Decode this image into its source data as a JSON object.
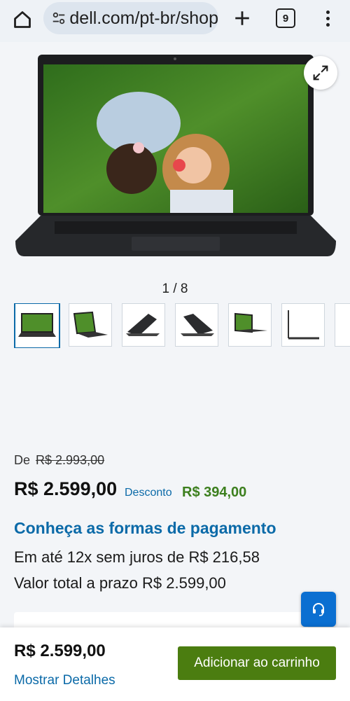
{
  "browser": {
    "url": "dell.com/pt-br/shop",
    "tab_count": "9"
  },
  "gallery": {
    "counter": "1 / 8",
    "thumbnails": [
      "laptop-front",
      "laptop-angled-left",
      "laptop-back-left",
      "laptop-back-right",
      "laptop-angled-right",
      "laptop-side"
    ]
  },
  "price": {
    "from_label": "De",
    "old_price": "R$ 2.993,00",
    "current_price": "R$ 2.599,00",
    "discount_label": "Desconto",
    "discount_value": "R$ 394,00"
  },
  "payment": {
    "link_text": "Conheça as formas de pagamento",
    "installments": "Em até 12x sem juros de R$ 216,58",
    "total_term": "Valor total a prazo R$ 2.599,00"
  },
  "footer": {
    "price": "R$ 2.599,00",
    "details_link": "Mostrar Detalhes",
    "add_to_cart": "Adicionar ao carrinho"
  },
  "colors": {
    "link_blue": "#0b6aa8",
    "cta_green": "#4b7d10",
    "discount_green": "#3c7f1e",
    "chat_blue": "#0b6fd1"
  },
  "icons": [
    "home-icon",
    "site-settings-icon",
    "plus-icon",
    "tabs-icon",
    "more-vert-icon",
    "expand-icon",
    "headset-icon"
  ]
}
